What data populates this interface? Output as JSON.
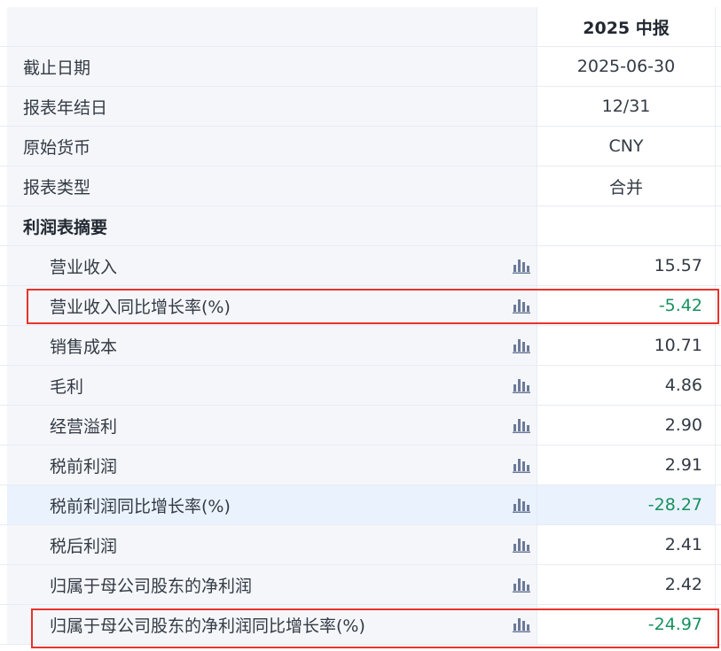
{
  "header": {
    "period": "2025 中报"
  },
  "meta_rows": [
    {
      "label": "截止日期",
      "value": "2025-06-30"
    },
    {
      "label": "报表年结日",
      "value": "12/31"
    },
    {
      "label": "原始货币",
      "value": "CNY"
    },
    {
      "label": "报表类型",
      "value": "合并"
    }
  ],
  "section": {
    "title": "利润表摘要"
  },
  "items": [
    {
      "label": "营业收入",
      "value": "15.57",
      "negative": false,
      "icon": "bar-chart-icon"
    },
    {
      "label": "营业收入同比增长率(%)",
      "value": "-5.42",
      "negative": true,
      "icon": "bar-chart-icon"
    },
    {
      "label": "销售成本",
      "value": "10.71",
      "negative": false,
      "icon": "bar-chart-icon"
    },
    {
      "label": "毛利",
      "value": "4.86",
      "negative": false,
      "icon": "bar-chart-icon"
    },
    {
      "label": "经营溢利",
      "value": "2.90",
      "negative": false,
      "icon": "bar-chart-icon"
    },
    {
      "label": "税前利润",
      "value": "2.91",
      "negative": false,
      "icon": "bar-chart-icon"
    },
    {
      "label": "税前利润同比增长率(%)",
      "value": "-28.27",
      "negative": true,
      "icon": "bar-chart-icon"
    },
    {
      "label": "税后利润",
      "value": "2.41",
      "negative": false,
      "icon": "bar-chart-icon"
    },
    {
      "label": "归属于母公司股东的净利润",
      "value": "2.42",
      "negative": false,
      "icon": "bar-chart-icon"
    },
    {
      "label": "归属于母公司股东的净利润同比增长率(%)",
      "value": "-24.97",
      "negative": true,
      "icon": "bar-chart-icon"
    }
  ],
  "colors": {
    "highlight_border": "#e8332b",
    "negative_value": "#16925e",
    "hover_row": "#eaf2fd",
    "label_bg": "#f4f6fa"
  }
}
